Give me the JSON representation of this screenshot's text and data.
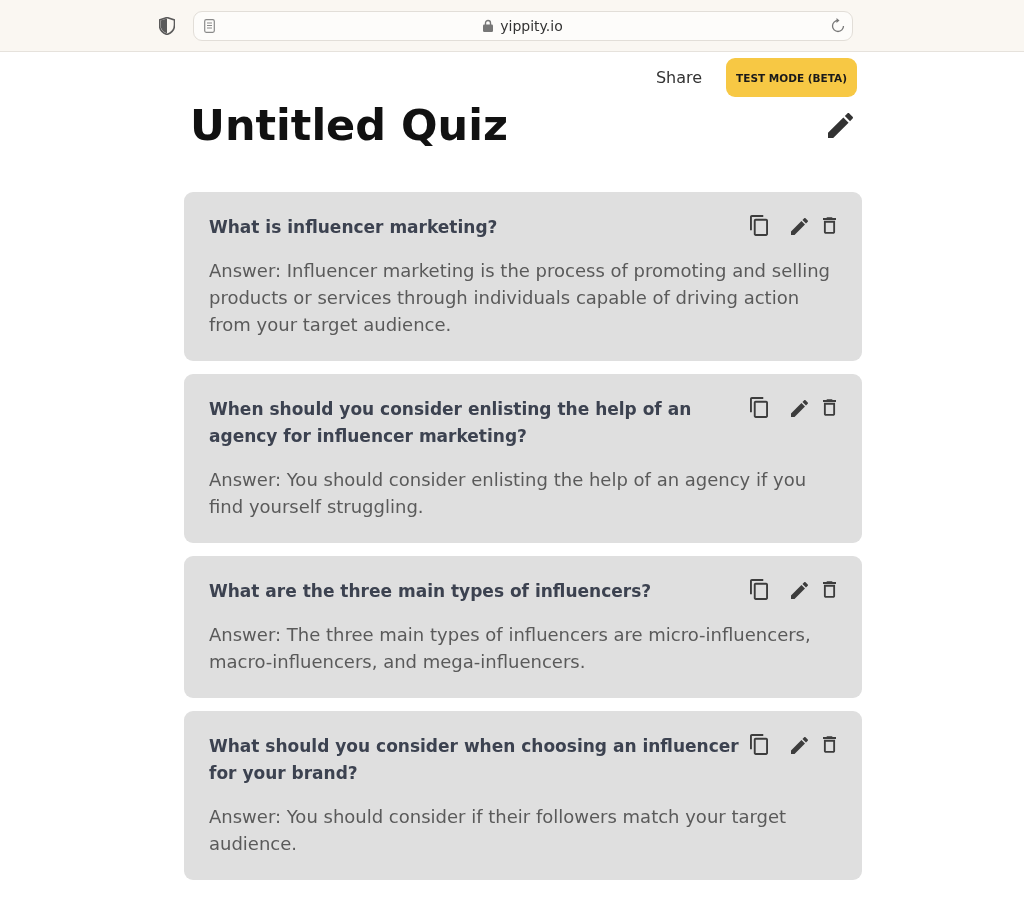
{
  "browser": {
    "url": "yippity.io"
  },
  "header": {
    "share": "Share",
    "test_mode_button": "TEST MODE (BETA)"
  },
  "quiz": {
    "title": "Untitled Quiz"
  },
  "questions": [
    {
      "question": "What is influencer marketing?",
      "answer": "Answer: Influencer marketing is the process of promoting and selling products or services through individuals capable of driving action from your target audience."
    },
    {
      "question": "When should you consider enlisting the help of an agency for influencer marketing?",
      "answer": "Answer: You should consider enlisting the help of an agency if you find yourself struggling."
    },
    {
      "question": "What are the three main types of influencers?",
      "answer": "Answer: The three main types of influencers are micro-influencers, macro-influencers, and mega-influencers."
    },
    {
      "question": "What should you consider when choosing an influencer for your brand?",
      "answer": "Answer: You should consider if their followers match your target audience."
    }
  ]
}
